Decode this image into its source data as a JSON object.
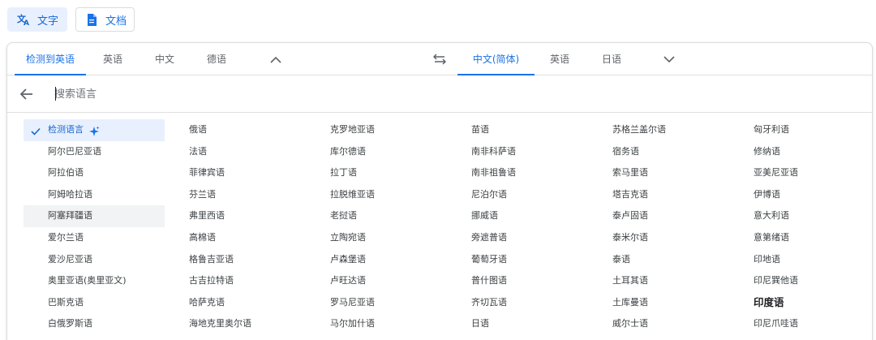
{
  "modes": {
    "text_label": "文字",
    "doc_label": "文档"
  },
  "source_tabs": [
    "检测到英语",
    "英语",
    "中文",
    "德语"
  ],
  "target_tabs": [
    "中文(简体)",
    "英语",
    "日语"
  ],
  "search": {
    "placeholder": "搜索语言"
  },
  "languages": {
    "col0": [
      "检测语言",
      "阿尔巴尼亚语",
      "阿拉伯语",
      "阿姆哈拉语",
      "阿塞拜疆语",
      "爱尔兰语",
      "爱沙尼亚语",
      "奥里亚语(奥里亚文)",
      "巴斯克语",
      "白俄罗斯语"
    ],
    "col1": [
      "俄语",
      "法语",
      "菲律宾语",
      "芬兰语",
      "弗里西语",
      "高棉语",
      "格鲁吉亚语",
      "古吉拉特语",
      "哈萨克语",
      "海地克里奥尔语"
    ],
    "col2": [
      "克罗地亚语",
      "库尔德语",
      "拉丁语",
      "拉脱维亚语",
      "老挝语",
      "立陶宛语",
      "卢森堡语",
      "卢旺达语",
      "罗马尼亚语",
      "马尔加什语"
    ],
    "col3": [
      "苗语",
      "南非科萨语",
      "南非祖鲁语",
      "尼泊尔语",
      "挪威语",
      "旁遮普语",
      "葡萄牙语",
      "普什图语",
      "齐切瓦语",
      "日语"
    ],
    "col4": [
      "苏格兰盖尔语",
      "宿务语",
      "索马里语",
      "塔吉克语",
      "泰卢固语",
      "泰米尔语",
      "泰语",
      "土耳其语",
      "土库曼语",
      "威尔士语"
    ],
    "col5": [
      "匈牙利语",
      "修纳语",
      "亚美尼亚语",
      "伊博语",
      "意大利语",
      "意第绪语",
      "印地语",
      "印尼巽他语",
      "印度语",
      "印尼爪哇语"
    ]
  },
  "colors": {
    "accent": "#1a73e8",
    "selected_bg": "#e8f0fe",
    "hover_bg": "#f1f3f4"
  },
  "icons": [
    "translate-icon",
    "document-icon",
    "chevron-up-icon",
    "swap-icon",
    "chevron-down-icon",
    "back-arrow-icon",
    "check-icon",
    "sparkle-icon"
  ]
}
